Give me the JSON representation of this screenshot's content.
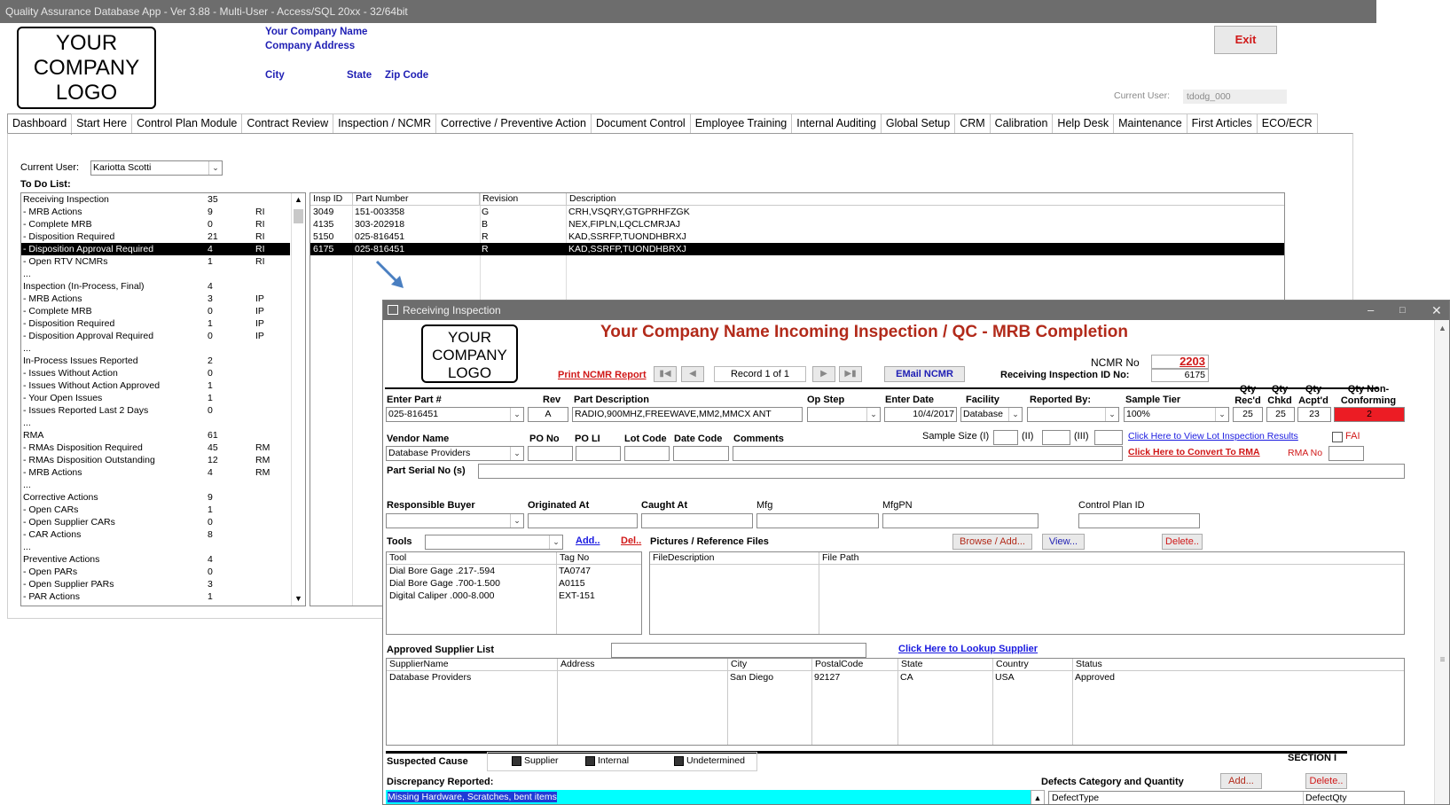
{
  "app": {
    "title": "Quality Assurance Database App - Ver 3.88 - Multi-User - Access/SQL 20xx - 32/64bit"
  },
  "company": {
    "logo": "YOUR COMPANY LOGO",
    "name": "Your Company Name",
    "address": "Company Address",
    "city": "City",
    "state": "State",
    "zip": "Zip Code"
  },
  "exit_label": "Exit",
  "current_user_top": {
    "label": "Current User:",
    "value": "tdodg_000"
  },
  "tabs": [
    "Dashboard",
    "Start Here",
    "Control Plan Module",
    "Contract Review",
    "Inspection / NCMR",
    "Corrective / Preventive Action",
    "Document Control",
    "Employee Training",
    "Internal Auditing",
    "Global Setup",
    "CRM",
    "Calibration",
    "Help Desk",
    "Maintenance",
    "First Articles",
    "ECO/ECR"
  ],
  "dashboard": {
    "current_user_label": "Current User:",
    "current_user": "Kariotta Scotti",
    "todo_label": "To Do List:",
    "todo": [
      [
        "Receiving Inspection",
        "35",
        ""
      ],
      [
        " - MRB Actions",
        "9",
        "RI"
      ],
      [
        " - Complete MRB",
        "0",
        "RI"
      ],
      [
        " - Disposition Required",
        "21",
        "RI"
      ],
      [
        " - Disposition Approval Required",
        "4",
        "RI"
      ],
      [
        " - Open RTV NCMRs",
        "1",
        "RI"
      ],
      [
        "...",
        "",
        ""
      ],
      [
        "Inspection (In-Process, Final)",
        "4",
        ""
      ],
      [
        " - MRB Actions",
        "3",
        "IP"
      ],
      [
        " - Complete MRB",
        "0",
        "IP"
      ],
      [
        " - Disposition Required",
        "1",
        "IP"
      ],
      [
        " - Disposition Approval Required",
        "0",
        "IP"
      ],
      [
        "...",
        "",
        ""
      ],
      [
        "In-Process Issues Reported",
        "2",
        ""
      ],
      [
        " - Issues Without Action",
        "0",
        ""
      ],
      [
        " - Issues Without Action Approved",
        "1",
        ""
      ],
      [
        " - Your Open Issues",
        "1",
        ""
      ],
      [
        " - Issues Reported Last 2 Days",
        "0",
        ""
      ],
      [
        "...",
        "",
        ""
      ],
      [
        "RMA",
        "61",
        ""
      ],
      [
        " - RMAs Disposition Required",
        "45",
        "RM"
      ],
      [
        " - RMAs Disposition Outstanding",
        "12",
        "RM"
      ],
      [
        " - MRB Actions",
        "4",
        "RM"
      ],
      [
        "...",
        "",
        ""
      ],
      [
        "Corrective Actions",
        "9",
        ""
      ],
      [
        " - Open CARs",
        "1",
        ""
      ],
      [
        " - Open Supplier CARs",
        "0",
        ""
      ],
      [
        " - CAR Actions",
        "8",
        ""
      ],
      [
        "...",
        "",
        ""
      ],
      [
        "Preventive Actions",
        "4",
        ""
      ],
      [
        " - Open PARs",
        "0",
        ""
      ],
      [
        " - Open Supplier PARs",
        "3",
        ""
      ],
      [
        " - PAR Actions",
        "1",
        ""
      ]
    ],
    "insp_headers": [
      "Insp ID",
      "Part Number",
      "Revision",
      "Description"
    ],
    "insp_rows": [
      [
        "3049",
        "151-003358",
        "G",
        "CRH,VSQRY,GTGPRHFZGK"
      ],
      [
        "4135",
        "303-202918",
        "B",
        "NEX,FIPLN,LQCLCMRJAJ"
      ],
      [
        "5150",
        "025-816451",
        "R",
        "KAD,SSRFP,TUONDHBRXJ"
      ],
      [
        "6175",
        "025-816451",
        "R",
        "KAD,SSRFP,TUONDHBRXJ"
      ]
    ]
  },
  "form": {
    "window_title": "Receiving Inspection",
    "logo": "YOUR COMPANY LOGO",
    "heading": "Your Company Name Incoming Inspection / QC - MRB Completion",
    "print_ncmr": "Print NCMR Report",
    "record": "Record 1 of 1",
    "email_ncmr": "EMail NCMR",
    "ncmr_label": "NCMR No",
    "ncmr_no": "2203",
    "ri_label": "Receiving Inspection ID No:",
    "ri_id": "6175",
    "labels": {
      "part": "Enter Part #",
      "rev": "Rev",
      "desc": "Part Description",
      "opstep": "Op Step",
      "enterdate": "Enter Date",
      "facility": "Facility",
      "reportedby": "Reported By:",
      "tier": "Sample Tier",
      "qrec": "Qty Rec'd",
      "qchk": "Qty Chkd",
      "qacpt": "Qty Acpt'd",
      "qnon": "Qty Non-Conforming",
      "vendor": "Vendor Name",
      "pono": "PO No",
      "poli": "PO LI",
      "lot": "Lot Code",
      "datecode": "Date Code",
      "comments": "Comments",
      "samplesize": "Sample Size (I)",
      "s2": "(II)",
      "s3": "(III)",
      "fai": "FAI",
      "rmano": "RMA No",
      "serial": "Part Serial No (s)",
      "buyer": "Responsible Buyer",
      "orig": "Originated At",
      "caught": "Caught At",
      "mfg": "Mfg",
      "mfgpn": "MfgPN",
      "cpid": "Control Plan ID",
      "tools": "Tools",
      "pics": "Pictures / Reference Files",
      "asl": "Approved Supplier List",
      "cause": "Suspected Cause",
      "disc": "Discrepancy Reported:",
      "defects": "Defects Category and Quantity",
      "section": "SECTION I"
    },
    "values": {
      "part": "025-816451",
      "rev": "A",
      "desc": "RADIO,900MHZ,FREEWAVE,MM2,MMCX ANT",
      "enterdate": "10/4/2017",
      "facility": "Database",
      "tier": "100%",
      "qrec": "25",
      "qchk": "25",
      "qacpt": "23",
      "qnon": "2",
      "vendor": "Database Providers",
      "disc": "Missing Hardware, Scratches, bent items"
    },
    "links": {
      "lot": "Click Here to View Lot Inspection Results",
      "rma": "Click Here to Convert To RMA",
      "lookup": "Click Here to Lookup Supplier",
      "add": "Add..",
      "del": "Del.."
    },
    "buttons": {
      "browse": "Browse / Add...",
      "view": "View...",
      "delete": "Delete..",
      "add": "Add...",
      "delete2": "Delete.."
    },
    "tool_headers": [
      "Tool",
      "Tag No"
    ],
    "tool_rows": [
      [
        "Dial Bore Gage .217-.594",
        "TA0747"
      ],
      [
        "Dial Bore Gage .700-1.500",
        "A0115"
      ],
      [
        "Digital Caliper .000-8.000",
        "EXT-151"
      ]
    ],
    "pic_headers": [
      "FileDescription",
      "File Path"
    ],
    "asl_headers": [
      "SupplierName",
      "Address",
      "City",
      "PostalCode",
      "State",
      "Country",
      "Status"
    ],
    "asl_rows": [
      [
        "Database Providers",
        "",
        "San Diego",
        "92127",
        "CA",
        "USA",
        "Approved"
      ]
    ],
    "cause_opts": [
      "Supplier",
      "Internal",
      "Undetermined"
    ],
    "defect_headers": [
      "DefectType",
      "DefectQty"
    ]
  }
}
